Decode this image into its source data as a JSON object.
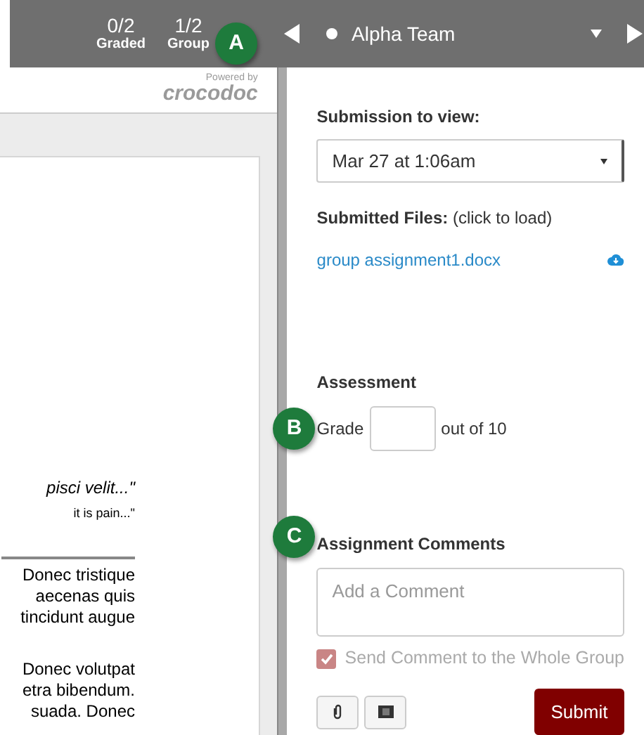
{
  "top_bar": {
    "stats": [
      {
        "value": "0/2",
        "label": "Graded"
      },
      {
        "value": "1/2",
        "label": "Group"
      }
    ],
    "student_select": {
      "value": "Alpha Team"
    }
  },
  "document": {
    "branding": {
      "small": "Powered by",
      "name": "crocodoc"
    },
    "quotes": [
      {
        "text": "pisci velit...\"",
        "italic": true
      },
      {
        "text": "it is pain...\"",
        "italic": false
      }
    ],
    "paragraphs": [
      [
        "Donec tristique",
        "aecenas quis",
        "tincidunt augue"
      ],
      [
        "Donec volutpat",
        "etra bibendum.",
        "suada. Donec"
      ]
    ]
  },
  "panel": {
    "submission_label": "Submission to view:",
    "submission_value": "Mar 27 at 1:06am",
    "files_label": "**Submitted Files:** (click to load)",
    "files": [
      {
        "name": "group assignment1.docx"
      }
    ],
    "assessment_title": "Assessment",
    "grade_label": "Grade",
    "grade_suffix": "out of 10",
    "comments_title": "Assignment Comments",
    "comment_placeholder": "Add a Comment",
    "group_checkbox": {
      "label": "Send Comment to the Whole Group",
      "checked": true,
      "disabled": true
    },
    "submit": "Submit"
  },
  "callouts": [
    {
      "letter": "A"
    },
    {
      "letter": "B"
    },
    {
      "letter": "C"
    }
  ]
}
